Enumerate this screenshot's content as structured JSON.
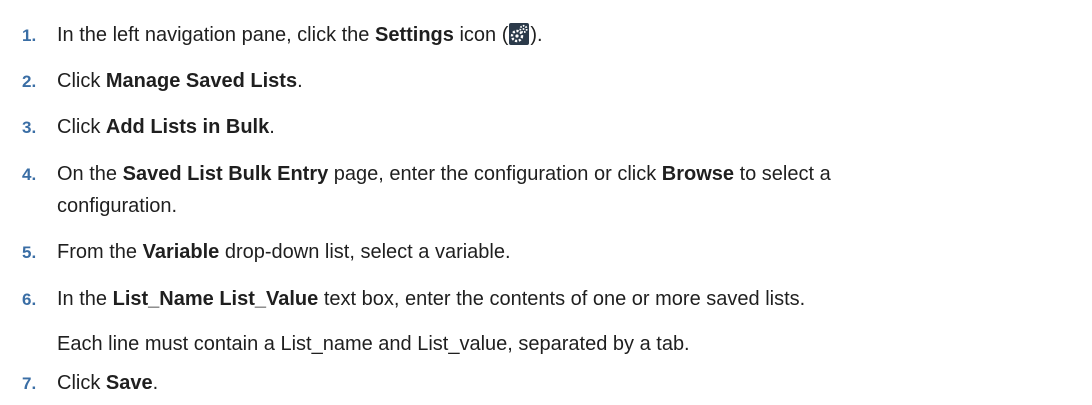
{
  "steps": [
    {
      "num": "1.",
      "parts": [
        "In the left navigation pane, click the ",
        "Settings",
        " icon (",
        ")."
      ],
      "icon": "settings-gear-icon"
    },
    {
      "num": "2.",
      "parts": [
        "Click ",
        "Manage Saved Lists",
        "."
      ]
    },
    {
      "num": "3.",
      "parts": [
        "Click ",
        "Add Lists in Bulk",
        "."
      ]
    },
    {
      "num": "4.",
      "parts": [
        "On the ",
        "Saved List Bulk Entry",
        " page, enter the configuration or click ",
        "Browse",
        " to select a",
        "configuration."
      ]
    },
    {
      "num": "5.",
      "parts": [
        "From the ",
        "Variable",
        " drop-down list, select a variable."
      ]
    },
    {
      "num": "6.",
      "parts": [
        "In the ",
        "List_Name List_Value",
        " text box, enter the contents of one or more saved lists."
      ],
      "note": "Each line must contain a List_name and List_value, separated by a tab."
    },
    {
      "num": "7.",
      "parts": [
        "Click ",
        "Save",
        "."
      ]
    }
  ],
  "colors": {
    "number": "#3a6ea5",
    "text": "#1f1f1f",
    "icon_bg": "#2b3a4a"
  }
}
